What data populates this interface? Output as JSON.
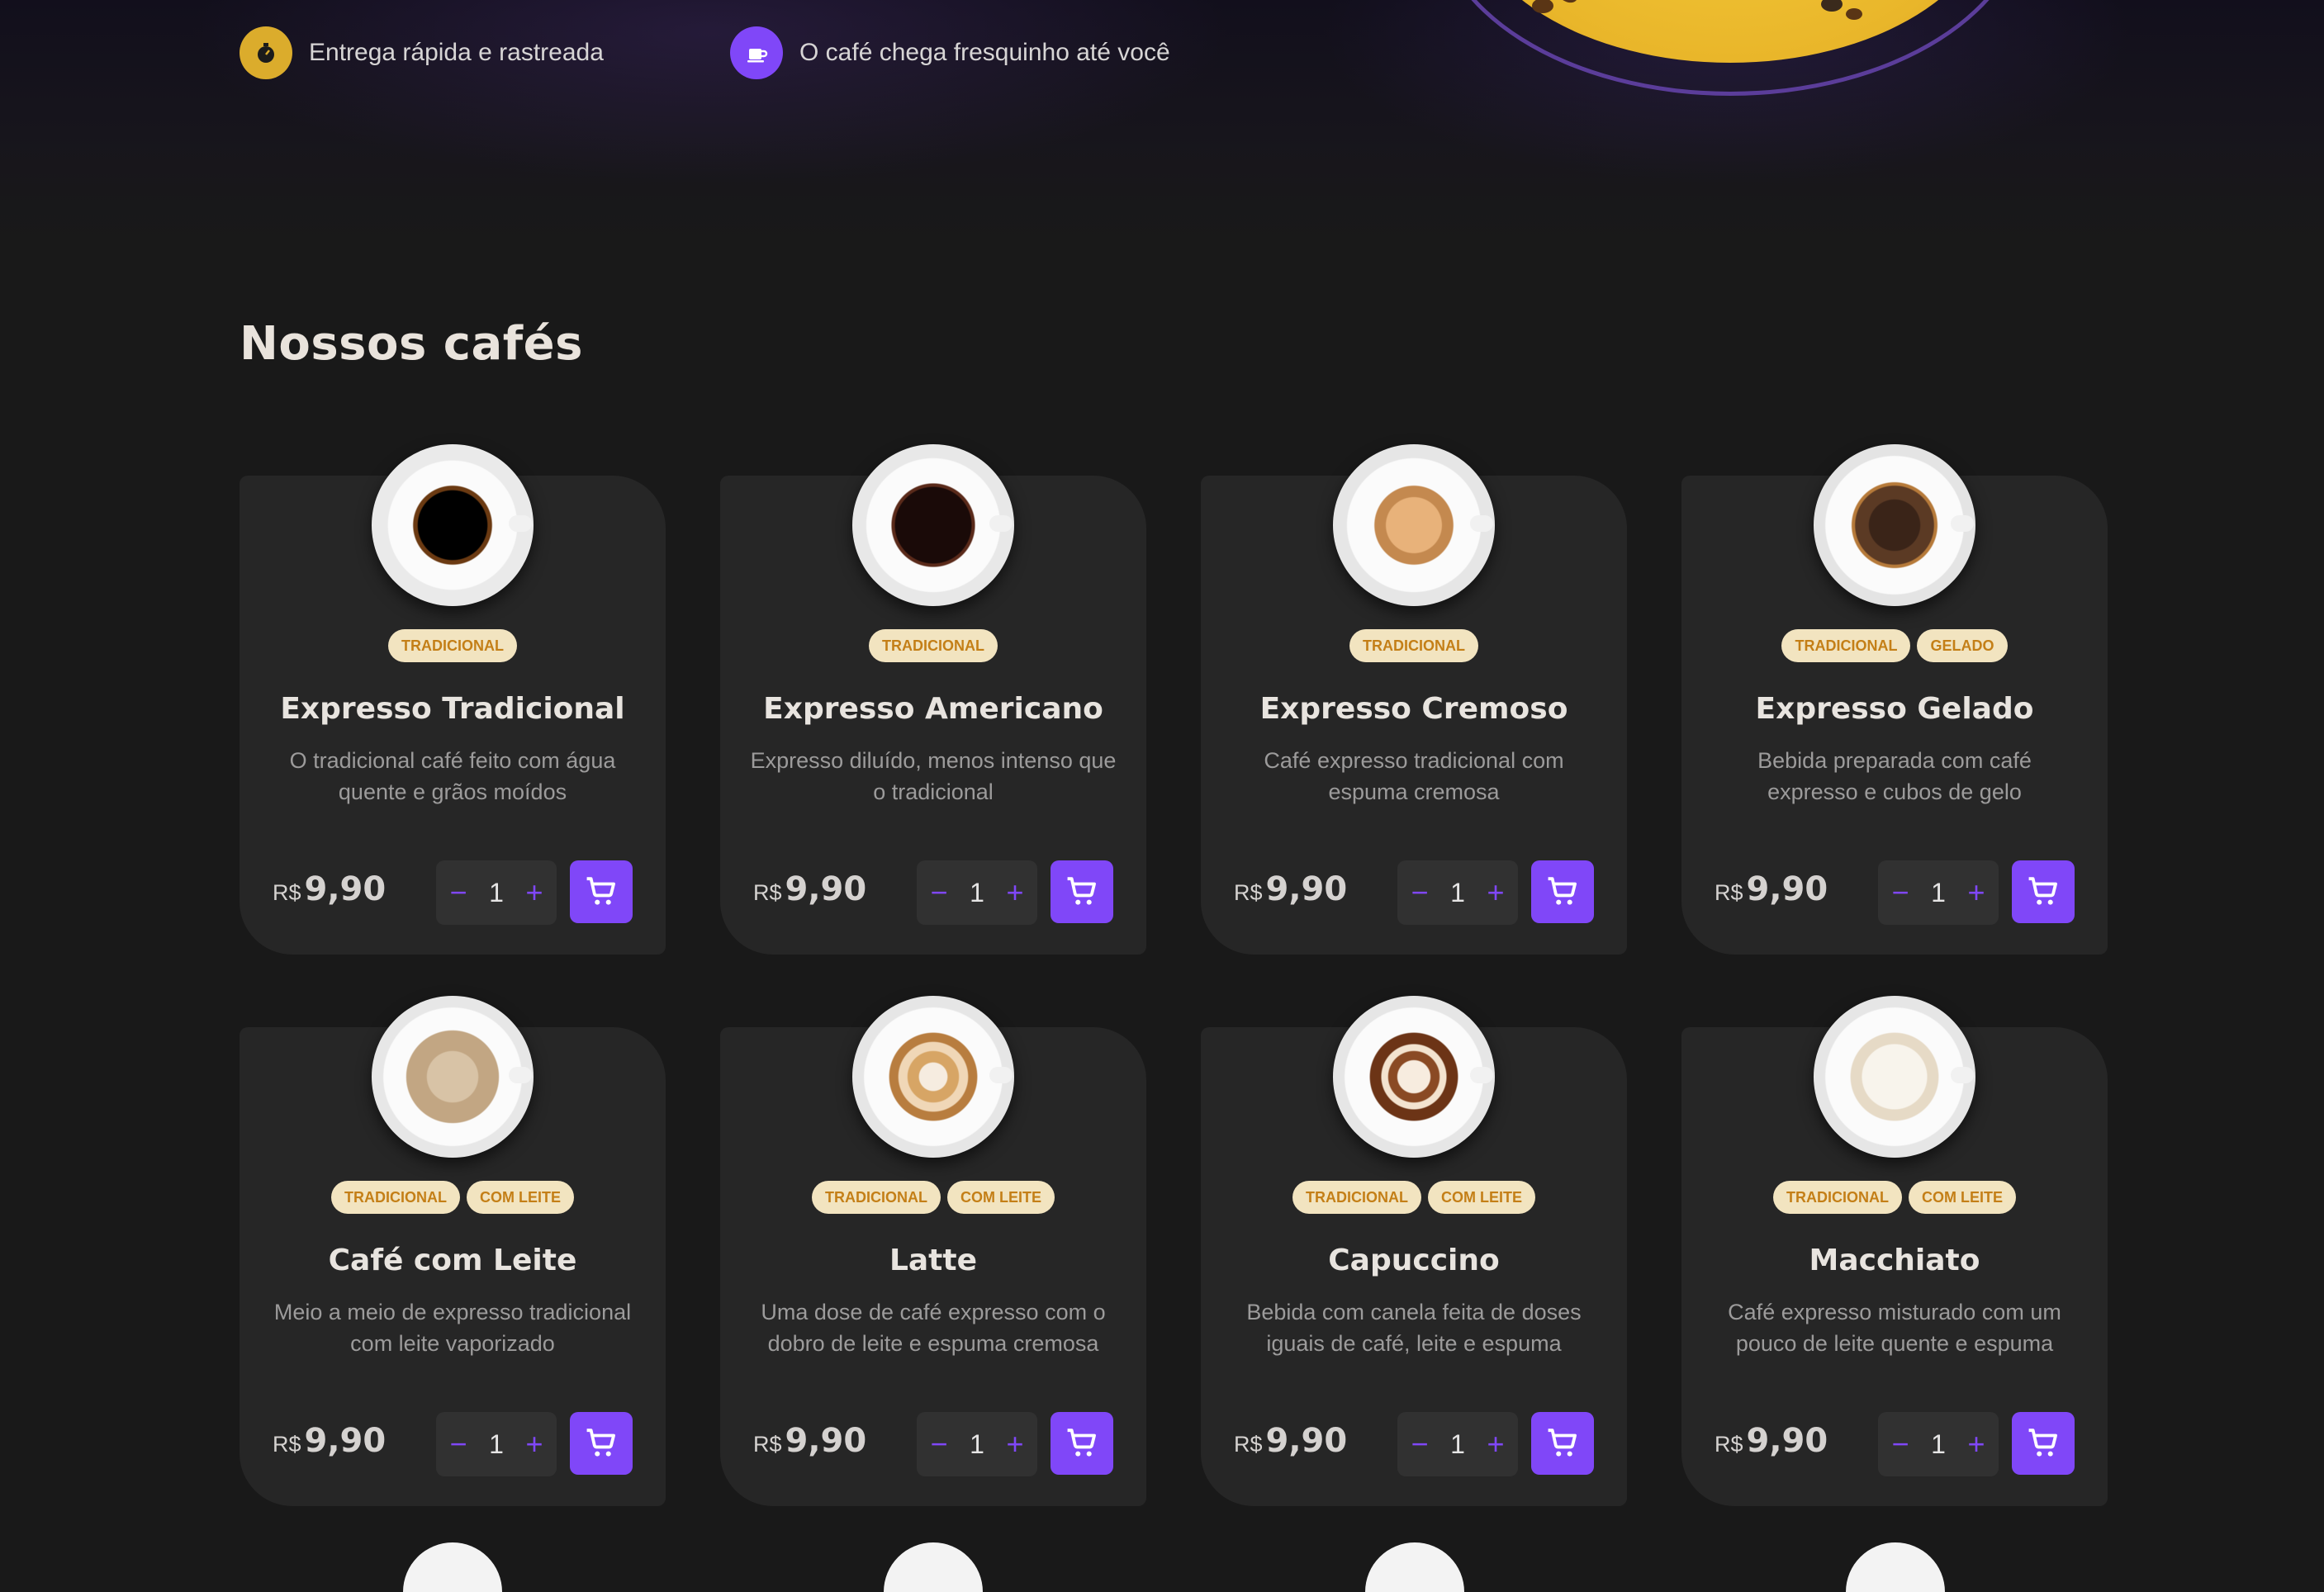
{
  "features": [
    {
      "icon": "timer-icon",
      "color": "#DBAC2C",
      "text": "Entrega rápida e rastreada"
    },
    {
      "icon": "coffee-icon",
      "color": "#8047F8",
      "text": "O café chega fresquinho até você"
    }
  ],
  "section_title": "Nossos cafés",
  "currency": "R$",
  "colors": {
    "accent": "#8047F8",
    "tag_bg": "#F2E4C0",
    "tag_text": "#C47F17",
    "card_bg": "#262626",
    "page_bg": "#191919"
  },
  "coffees": [
    {
      "name": "Expresso Tradicional",
      "tags": [
        "Tradicional"
      ],
      "description": "O tradicional café feito com água quente e grãos moídos",
      "price": "9,90",
      "quantity": "1",
      "style": "black"
    },
    {
      "name": "Expresso Americano",
      "tags": [
        "Tradicional"
      ],
      "description": "Expresso diluído, menos intenso que o tradicional",
      "price": "9,90",
      "quantity": "1",
      "style": "americano"
    },
    {
      "name": "Expresso Cremoso",
      "tags": [
        "Tradicional"
      ],
      "description": "Café expresso tradicional com espuma cremosa",
      "price": "9,90",
      "quantity": "1",
      "style": "cream"
    },
    {
      "name": "Expresso Gelado",
      "tags": [
        "Tradicional",
        "Gelado"
      ],
      "description": "Bebida preparada com café expresso e cubos de gelo",
      "price": "9,90",
      "quantity": "1",
      "style": "iced"
    },
    {
      "name": "Café com Leite",
      "tags": [
        "Tradicional",
        "Com leite"
      ],
      "description": "Meio a meio de expresso tradicional com leite vaporizado",
      "price": "9,90",
      "quantity": "1",
      "style": "milk"
    },
    {
      "name": "Latte",
      "tags": [
        "Tradicional",
        "Com leite"
      ],
      "description": "Uma dose de café expresso com o dobro de leite e espuma cremosa",
      "price": "9,90",
      "quantity": "1",
      "style": "latte"
    },
    {
      "name": "Capuccino",
      "tags": [
        "Tradicional",
        "Com leite"
      ],
      "description": "Bebida com canela feita de doses iguais de café, leite e espuma",
      "price": "9,90",
      "quantity": "1",
      "style": "capuccino"
    },
    {
      "name": "Macchiato",
      "tags": [
        "Tradicional",
        "Com leite"
      ],
      "description": "Café expresso misturado com um pouco de leite quente e espuma",
      "price": "9,90",
      "quantity": "1",
      "style": "macchiato"
    }
  ]
}
